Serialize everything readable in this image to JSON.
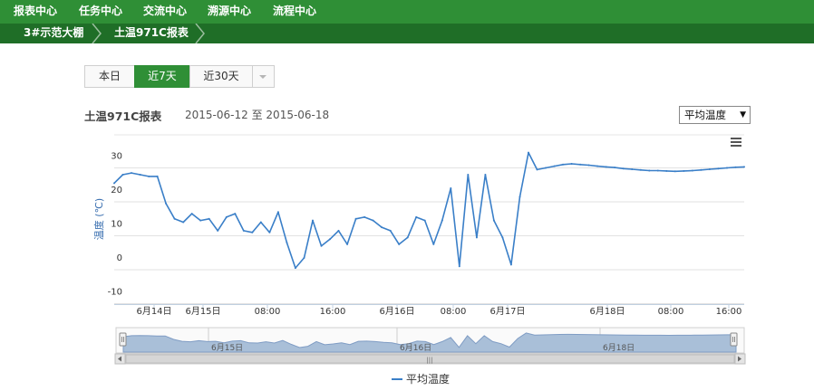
{
  "topnav": {
    "items": [
      {
        "label": "报表中心"
      },
      {
        "label": "任务中心"
      },
      {
        "label": "交流中心"
      },
      {
        "label": "溯源中心"
      },
      {
        "label": "流程中心"
      }
    ]
  },
  "breadcrumb": {
    "items": [
      {
        "label": "3#示范大棚"
      },
      {
        "label": "土温971C报表"
      }
    ]
  },
  "period_tabs": {
    "items": [
      {
        "label": "本日",
        "active": false
      },
      {
        "label": "近7天",
        "active": true
      },
      {
        "label": "近30天",
        "active": false
      }
    ],
    "dropdown_icon": "caret-down-icon"
  },
  "report": {
    "title": "土温971C报表",
    "start_date": "2015-06-12",
    "range_sep": "至",
    "end_date": "2015-06-18"
  },
  "metric_select": {
    "selected": "平均温度",
    "arrow": "▼"
  },
  "colors": {
    "nav_green": "#2f8f36",
    "crumb_green": "#1f6e27",
    "series": "#3a7fc8",
    "navigator_fill": "#a9bfd8"
  },
  "chart_data": {
    "type": "line",
    "title": "",
    "ylabel": "温度 (℃)",
    "ylim": [
      -10,
      40
    ],
    "yticks": [
      "-10",
      "0",
      "10",
      "20",
      "30"
    ],
    "grid": true,
    "legend_position": "bottom-center",
    "menu_icon": "hamburger-menu-icon",
    "xticks": [
      "6月14日",
      "6月15日",
      "08:00",
      "16:00",
      "6月16日",
      "08:00",
      "6月17日",
      "6月18日",
      "08:00",
      "16:00"
    ],
    "navigator_labels": [
      "6月15日",
      "6月16日",
      "6月18日"
    ],
    "scroll_handle": "|||",
    "series": [
      {
        "name": "平均温度",
        "x": [
          0,
          3,
          6,
          9,
          12,
          15,
          18,
          21,
          24,
          27,
          30,
          33,
          36,
          39,
          42,
          45,
          48,
          51,
          54,
          57,
          60,
          63,
          66,
          69,
          72,
          75,
          78,
          81,
          84,
          87,
          90,
          93,
          96,
          99,
          102,
          105,
          108,
          111,
          114,
          117,
          120,
          123,
          126,
          129,
          132,
          135,
          138,
          141,
          144,
          147,
          150,
          153,
          156,
          159,
          162,
          165,
          168,
          171,
          174,
          177,
          180,
          183,
          186,
          189,
          192,
          195,
          198,
          201,
          204,
          207,
          210,
          213,
          216,
          219
        ],
        "values": [
          25.5,
          28,
          28.5,
          28,
          27.5,
          27.5,
          19.5,
          15,
          14,
          16.5,
          14.5,
          15,
          11.5,
          15.5,
          16.5,
          11.5,
          11,
          14,
          11,
          17,
          8,
          0.5,
          3.5,
          14.5,
          7,
          9,
          11.5,
          7.5,
          15,
          15.5,
          14.5,
          12.5,
          11.5,
          7.5,
          9.5,
          15.5,
          14.5,
          7.5,
          14.5,
          24,
          1,
          28,
          9.5,
          28,
          14.5,
          9.5,
          1.5,
          21.5,
          34.5,
          29.5,
          30,
          30.5,
          31,
          31.2,
          31,
          30.8,
          30.5,
          30.3,
          30.1,
          29.8,
          29.6,
          29.4,
          29.2,
          29.2,
          29.1,
          29.0,
          29.1,
          29.2,
          29.4,
          29.6,
          29.8,
          30.0,
          30.2,
          30.3
        ]
      }
    ]
  }
}
